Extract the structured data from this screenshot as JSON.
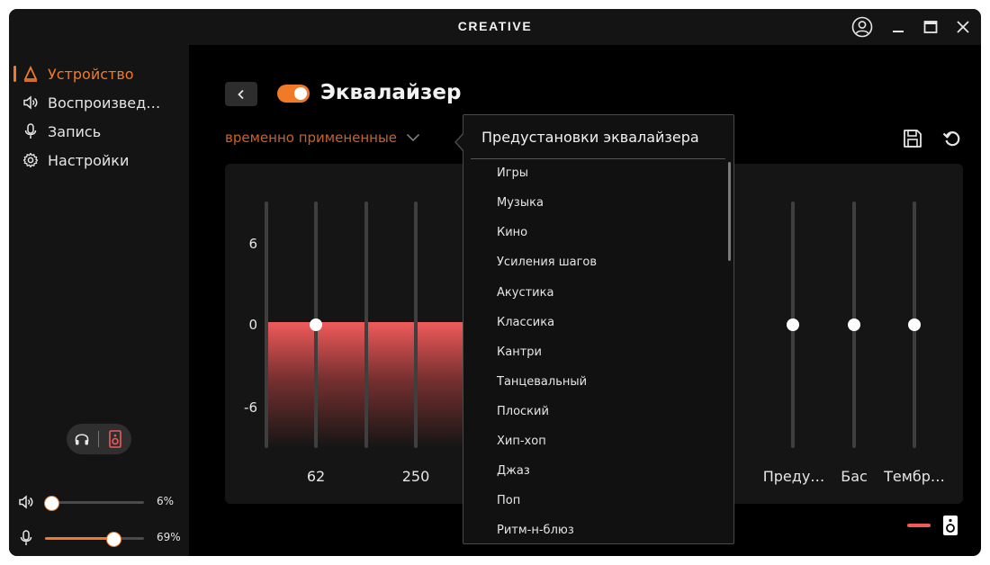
{
  "app": {
    "brand": "CREATIVE"
  },
  "sidebar": {
    "items": [
      {
        "label": "Устройство",
        "icon": "device-icon",
        "active": true
      },
      {
        "label": "Воспроизвед…",
        "icon": "speaker-icon",
        "active": false
      },
      {
        "label": "Запись",
        "icon": "microphone-icon",
        "active": false
      },
      {
        "label": "Настройки",
        "icon": "gear-icon",
        "active": false
      }
    ],
    "output_toggle": {
      "left_icon": "headphones-icon",
      "right_icon": "speaker-box-icon",
      "selected": "speaker"
    },
    "playback_volume": {
      "value": 6,
      "label": "6%"
    },
    "mic_volume": {
      "value": 69,
      "label": "69%"
    }
  },
  "main": {
    "title": "Эквалайзер",
    "enabled": true,
    "preset_value": "временно примененные",
    "y_labels": [
      "6",
      "0",
      "-6"
    ],
    "band_labels": [
      "62",
      "250"
    ],
    "right_labels": [
      "Преду…",
      "Бас",
      "Тембр…"
    ],
    "bands": [
      {
        "gain": 0
      },
      {
        "gain": 0
      },
      {
        "gain": 0
      },
      {
        "gain": 0
      }
    ]
  },
  "presets": {
    "title": "Предустановки эквалайзера",
    "items": [
      "Игры",
      "Музыка",
      "Кино",
      "Усиления шагов",
      "Акустика",
      "Классика",
      "Кантри",
      "Танцевальный",
      "Плоский",
      "Хип-хоп",
      "Джаз",
      "Поп",
      "Ритм-н-блюз"
    ]
  },
  "colors": {
    "accent": "#f07a28",
    "eq_fill": "#ef5a5a",
    "background": "#000000",
    "panel": "#151515"
  }
}
